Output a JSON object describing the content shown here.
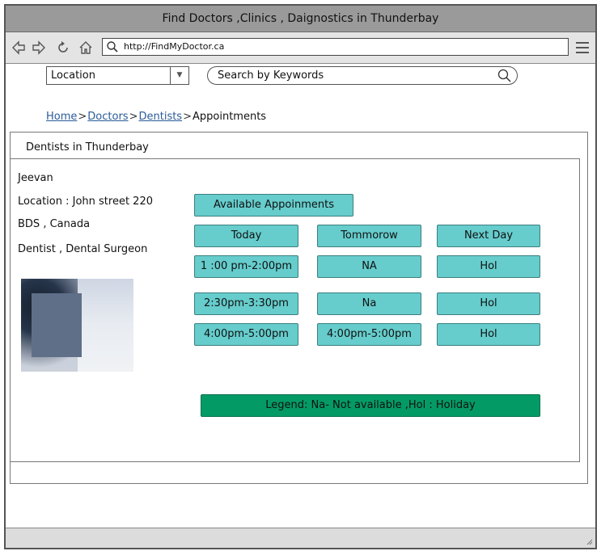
{
  "window": {
    "title": "Find Doctors ,Clinics , Daignostics in Thunderbay"
  },
  "browser": {
    "url": "http://FindMyDoctor.ca"
  },
  "filters": {
    "location": "Location",
    "search_placeholder": "Search by Keywords"
  },
  "breadcrumb": {
    "home": "Home",
    "doctors": "Doctors",
    "dentists": "Dentists",
    "current": "Appointments",
    "separator": ">"
  },
  "section": {
    "title": "Dentists in Thunderbay"
  },
  "doctor": {
    "name": "Jeevan",
    "location": "Location : John street 220",
    "degree": "BDS , Canada",
    "specialty": "Dentist , Dental Surgeon"
  },
  "appointments": {
    "header": "Available Appoinments",
    "columns": [
      "Today",
      "Tommorow",
      "Next Day"
    ],
    "rows": [
      [
        "1 :00 pm-2:00pm",
        "NA",
        "Hol"
      ],
      [
        "2:30pm-3:30pm",
        "Na",
        "Hol"
      ],
      [
        "4:00pm-5:00pm",
        "4:00pm-5:00pm",
        "Hol"
      ]
    ],
    "legend": "Legend: Na- Not available ,Hol : Holiday"
  },
  "colors": {
    "slot_button": "#66cccc",
    "legend_bar": "#049a66",
    "titlebar": "#9a9a9a"
  }
}
